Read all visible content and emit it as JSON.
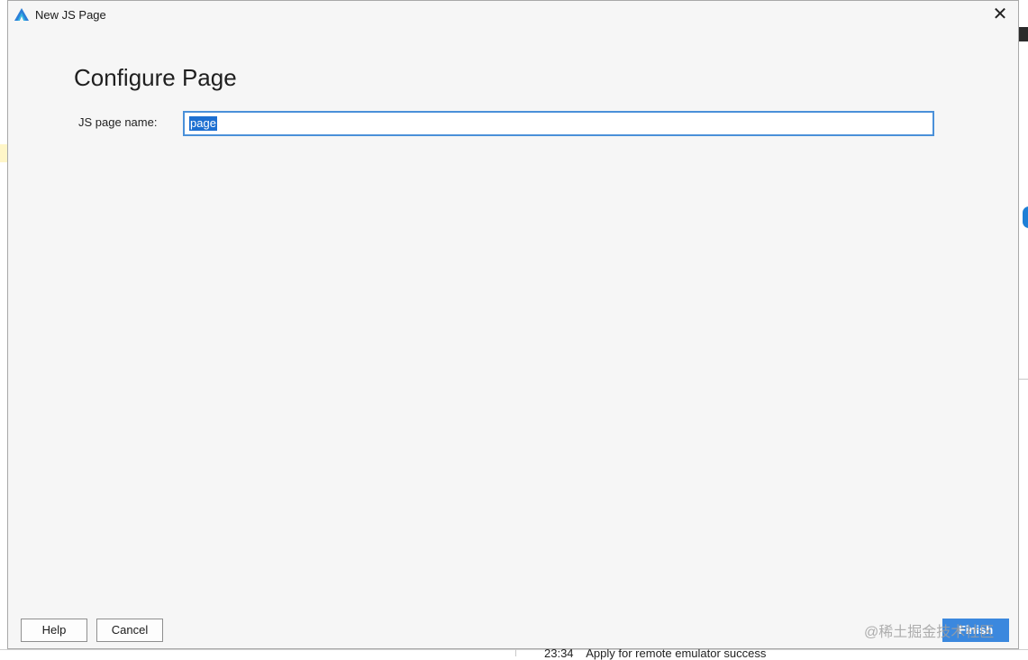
{
  "dialog": {
    "title": "New JS Page",
    "heading": "Configure Page",
    "field_label": "JS page name:",
    "page_name_value": "page",
    "buttons": {
      "help": "Help",
      "cancel": "Cancel",
      "finish": "Finish"
    },
    "close_icon": "close-icon",
    "app_icon": "devecostudio-logo-icon"
  },
  "background": {
    "log_line": "23:34    Apply for remote emulator success",
    "watermark": "@稀土掘金技术社区"
  },
  "colors": {
    "accent": "#3b88de",
    "selection": "#1d6fd1",
    "dialog_bg": "#f6f6f6"
  }
}
